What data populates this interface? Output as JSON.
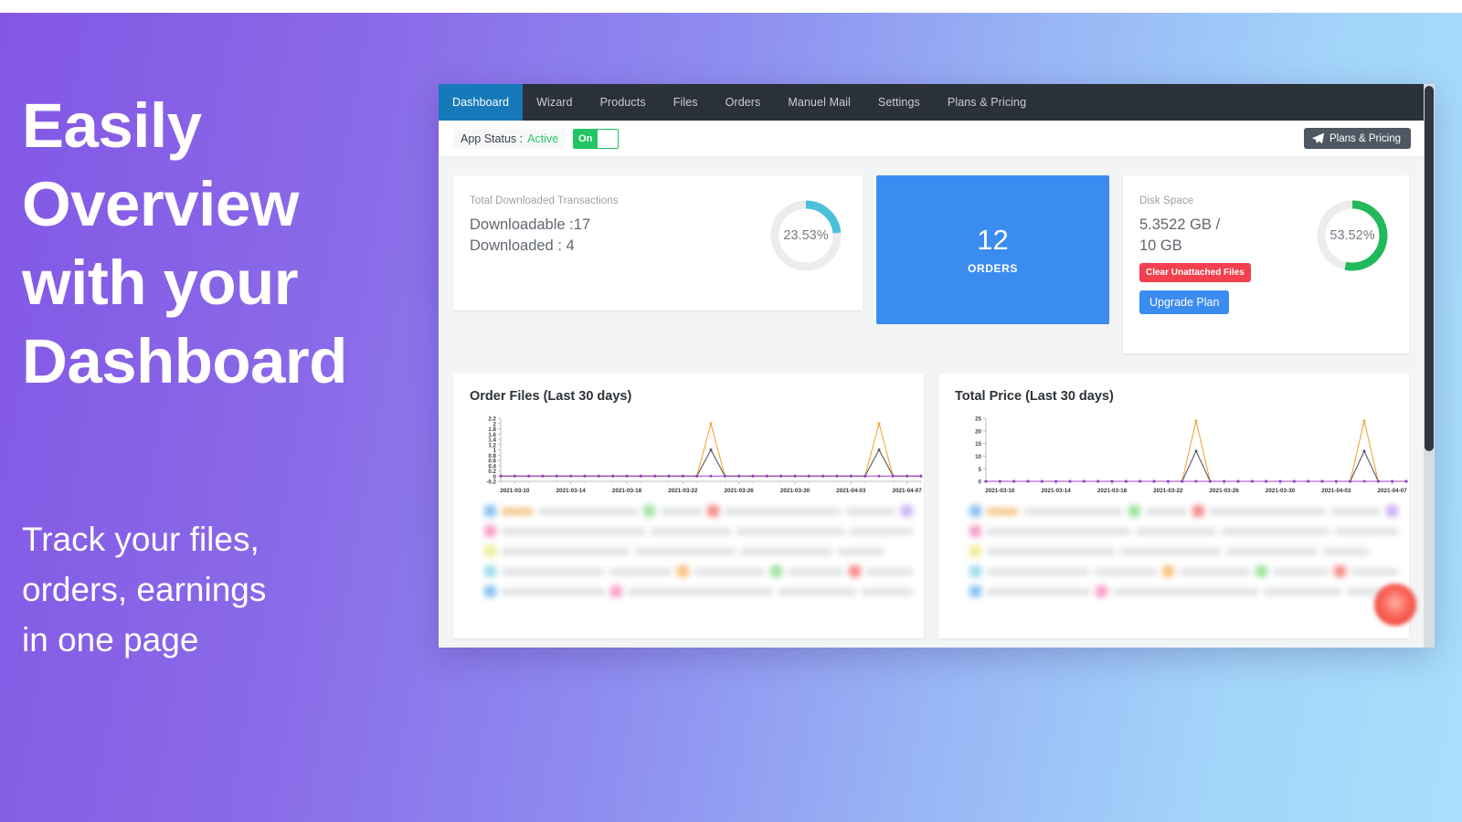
{
  "hero": {
    "title": "Easily\nOverview\nwith your\nDashboard",
    "subtitle": "Track your files,\norders, earnings\nin one page"
  },
  "theme": {
    "gradient_start": "#8357e5",
    "gradient_end": "#a8e0fb",
    "nav_bg": "#2b3138",
    "nav_active": "#1779ba",
    "accent_blue": "#3b8cf0",
    "accent_green": "#22c562",
    "accent_red": "#f2404e",
    "donut_teal": "#4bc0d9",
    "donut_green": "#22b95b",
    "donut_track": "#ececec",
    "series_orange": "#f6a33c",
    "series_gray": "#5c5560",
    "series_purple": "#9b3fc7"
  },
  "navbar": {
    "items": [
      {
        "label": "Dashboard",
        "active": true
      },
      {
        "label": "Wizard",
        "active": false
      },
      {
        "label": "Products",
        "active": false
      },
      {
        "label": "Files",
        "active": false
      },
      {
        "label": "Orders",
        "active": false
      },
      {
        "label": "Manuel Mail",
        "active": false
      },
      {
        "label": "Settings",
        "active": false
      },
      {
        "label": "Plans & Pricing",
        "active": false
      }
    ]
  },
  "statusbar": {
    "status_label": "App Status :",
    "status_value": "Active",
    "toggle_label": "On",
    "plans_button": "Plans & Pricing",
    "plans_icon": "paper-plane-icon"
  },
  "cards": {
    "downloads": {
      "kicker": "Total Downloaded Transactions",
      "line1": "Downloadable :17",
      "line2": "Downloaded : 4",
      "percent_label": "23.53%",
      "percent_value": 23.53
    },
    "orders": {
      "value": "12",
      "label": "ORDERS"
    },
    "disk": {
      "kicker": "Disk Space",
      "line1": "5.3522 GB /",
      "line2": "10 GB",
      "clear_button": "Clear Unattached Files",
      "upgrade_button": "Upgrade Plan",
      "percent_label": "53.52%",
      "percent_value": 53.52
    }
  },
  "chart_data": [
    {
      "type": "line",
      "title": "Order Files (Last 30 days)",
      "xlabel": "",
      "ylabel": "",
      "ylim": [
        -0.2,
        2.2
      ],
      "yticks": [
        2.2,
        2,
        1.8,
        1.6,
        1.4,
        1.2,
        1,
        0.8,
        0.6,
        0.4,
        0.2,
        0,
        -0.2
      ],
      "ytick_labels": [
        "2.2",
        "2",
        "1.8",
        "1.6",
        "1.4",
        "1.2",
        "1",
        "0.8",
        "0.6",
        "0.4",
        "0.2",
        "0",
        "-0.2"
      ],
      "grid": false,
      "legend": "none",
      "xtick_labels": [
        "2021-03-10",
        "2021-03-14",
        "2021-03-18",
        "2021-03-22",
        "2021-03-26",
        "2021-03-30",
        "2021-04-03",
        "2021-04-07"
      ],
      "x": [
        "2021-03-09",
        "2021-03-10",
        "2021-03-11",
        "2021-03-12",
        "2021-03-13",
        "2021-03-14",
        "2021-03-15",
        "2021-03-16",
        "2021-03-17",
        "2021-03-18",
        "2021-03-19",
        "2021-03-20",
        "2021-03-21",
        "2021-03-22",
        "2021-03-23",
        "2021-03-24",
        "2021-03-25",
        "2021-03-26",
        "2021-03-27",
        "2021-03-28",
        "2021-03-29",
        "2021-03-30",
        "2021-03-31",
        "2021-04-01",
        "2021-04-02",
        "2021-04-03",
        "2021-04-04",
        "2021-04-05",
        "2021-04-06",
        "2021-04-07",
        "2021-04-08"
      ],
      "series": [
        {
          "name": "orange",
          "color": "#f6a33c",
          "values": [
            0,
            0,
            0,
            0,
            0,
            0,
            0,
            0,
            0,
            0,
            0,
            0,
            0,
            0,
            0,
            2,
            0,
            0,
            0,
            0,
            0,
            0,
            0,
            0,
            0,
            0,
            0,
            2,
            0,
            0,
            0
          ]
        },
        {
          "name": "gray",
          "color": "#5c5560",
          "values": [
            0,
            0,
            0,
            0,
            0,
            0,
            0,
            0,
            0,
            0,
            0,
            0,
            0,
            0,
            0,
            1,
            0,
            0,
            0,
            0,
            0,
            0,
            0,
            0,
            0,
            0,
            0,
            1,
            0,
            0,
            0
          ]
        },
        {
          "name": "purple",
          "color": "#9b3fc7",
          "values": [
            0,
            0,
            0,
            0,
            0,
            0,
            0,
            0,
            0,
            0,
            0,
            0,
            0,
            0,
            0,
            0,
            0,
            0,
            0,
            0,
            0,
            0,
            0,
            0,
            0,
            0,
            0,
            0,
            0,
            0,
            0
          ]
        }
      ]
    },
    {
      "type": "line",
      "title": "Total Price (Last 30 days)",
      "xlabel": "",
      "ylabel": "",
      "ylim": [
        0,
        25
      ],
      "yticks": [
        25,
        20,
        15,
        10,
        5,
        0
      ],
      "ytick_labels": [
        "25",
        "20",
        "15",
        "10",
        "5",
        "0"
      ],
      "grid": false,
      "legend": "none",
      "xtick_labels": [
        "2021-03-10",
        "2021-03-14",
        "2021-03-18",
        "2021-03-22",
        "2021-03-26",
        "2021-03-30",
        "2021-04-03",
        "2021-04-07"
      ],
      "x": [
        "2021-03-09",
        "2021-03-10",
        "2021-03-11",
        "2021-03-12",
        "2021-03-13",
        "2021-03-14",
        "2021-03-15",
        "2021-03-16",
        "2021-03-17",
        "2021-03-18",
        "2021-03-19",
        "2021-03-20",
        "2021-03-21",
        "2021-03-22",
        "2021-03-23",
        "2021-03-24",
        "2021-03-25",
        "2021-03-26",
        "2021-03-27",
        "2021-03-28",
        "2021-03-29",
        "2021-03-30",
        "2021-03-31",
        "2021-04-01",
        "2021-04-02",
        "2021-04-03",
        "2021-04-04",
        "2021-04-05",
        "2021-04-06",
        "2021-04-07",
        "2021-04-08"
      ],
      "series": [
        {
          "name": "orange",
          "color": "#f6a33c",
          "values": [
            0,
            0,
            0,
            0,
            0,
            0,
            0,
            0,
            0,
            0,
            0,
            0,
            0,
            0,
            0,
            24,
            0,
            0,
            0,
            0,
            0,
            0,
            0,
            0,
            0,
            0,
            0,
            24,
            0,
            0,
            0
          ]
        },
        {
          "name": "gray",
          "color": "#5c5560",
          "values": [
            0,
            0,
            0,
            0,
            0,
            0,
            0,
            0,
            0,
            0,
            0,
            0,
            0,
            0,
            0,
            12,
            0,
            0,
            0,
            0,
            0,
            0,
            0,
            0,
            0,
            0,
            0,
            12,
            0,
            0,
            0
          ]
        },
        {
          "name": "purple",
          "color": "#9b3fc7",
          "values": [
            0,
            0,
            0,
            0,
            0,
            0,
            0,
            0,
            0,
            0,
            0,
            0,
            0,
            0,
            0,
            0,
            0,
            0,
            0,
            0,
            0,
            0,
            0,
            0,
            0,
            0,
            0,
            0,
            0,
            0,
            0
          ]
        }
      ]
    }
  ]
}
